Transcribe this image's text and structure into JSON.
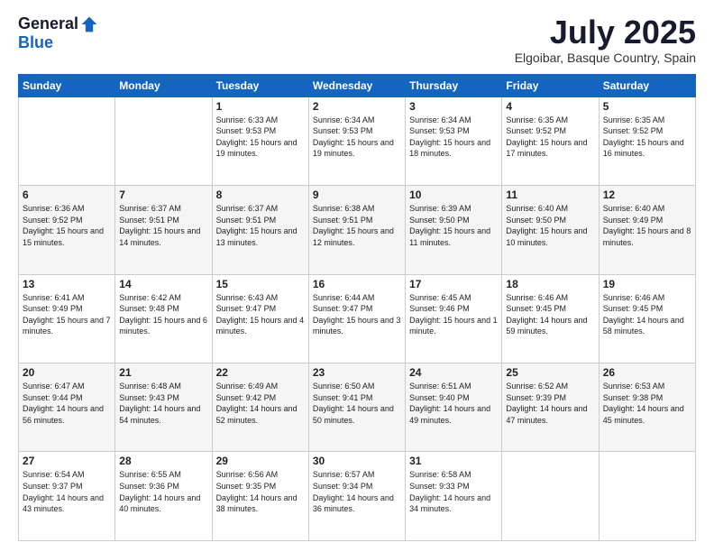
{
  "logo": {
    "general": "General",
    "blue": "Blue"
  },
  "title": "July 2025",
  "location": "Elgoibar, Basque Country, Spain",
  "days_of_week": [
    "Sunday",
    "Monday",
    "Tuesday",
    "Wednesday",
    "Thursday",
    "Friday",
    "Saturday"
  ],
  "weeks": [
    [
      {
        "day": null,
        "sunrise": null,
        "sunset": null,
        "daylight": null
      },
      {
        "day": null,
        "sunrise": null,
        "sunset": null,
        "daylight": null
      },
      {
        "day": "1",
        "sunrise": "Sunrise: 6:33 AM",
        "sunset": "Sunset: 9:53 PM",
        "daylight": "Daylight: 15 hours and 19 minutes."
      },
      {
        "day": "2",
        "sunrise": "Sunrise: 6:34 AM",
        "sunset": "Sunset: 9:53 PM",
        "daylight": "Daylight: 15 hours and 19 minutes."
      },
      {
        "day": "3",
        "sunrise": "Sunrise: 6:34 AM",
        "sunset": "Sunset: 9:53 PM",
        "daylight": "Daylight: 15 hours and 18 minutes."
      },
      {
        "day": "4",
        "sunrise": "Sunrise: 6:35 AM",
        "sunset": "Sunset: 9:52 PM",
        "daylight": "Daylight: 15 hours and 17 minutes."
      },
      {
        "day": "5",
        "sunrise": "Sunrise: 6:35 AM",
        "sunset": "Sunset: 9:52 PM",
        "daylight": "Daylight: 15 hours and 16 minutes."
      }
    ],
    [
      {
        "day": "6",
        "sunrise": "Sunrise: 6:36 AM",
        "sunset": "Sunset: 9:52 PM",
        "daylight": "Daylight: 15 hours and 15 minutes."
      },
      {
        "day": "7",
        "sunrise": "Sunrise: 6:37 AM",
        "sunset": "Sunset: 9:51 PM",
        "daylight": "Daylight: 15 hours and 14 minutes."
      },
      {
        "day": "8",
        "sunrise": "Sunrise: 6:37 AM",
        "sunset": "Sunset: 9:51 PM",
        "daylight": "Daylight: 15 hours and 13 minutes."
      },
      {
        "day": "9",
        "sunrise": "Sunrise: 6:38 AM",
        "sunset": "Sunset: 9:51 PM",
        "daylight": "Daylight: 15 hours and 12 minutes."
      },
      {
        "day": "10",
        "sunrise": "Sunrise: 6:39 AM",
        "sunset": "Sunset: 9:50 PM",
        "daylight": "Daylight: 15 hours and 11 minutes."
      },
      {
        "day": "11",
        "sunrise": "Sunrise: 6:40 AM",
        "sunset": "Sunset: 9:50 PM",
        "daylight": "Daylight: 15 hours and 10 minutes."
      },
      {
        "day": "12",
        "sunrise": "Sunrise: 6:40 AM",
        "sunset": "Sunset: 9:49 PM",
        "daylight": "Daylight: 15 hours and 8 minutes."
      }
    ],
    [
      {
        "day": "13",
        "sunrise": "Sunrise: 6:41 AM",
        "sunset": "Sunset: 9:49 PM",
        "daylight": "Daylight: 15 hours and 7 minutes."
      },
      {
        "day": "14",
        "sunrise": "Sunrise: 6:42 AM",
        "sunset": "Sunset: 9:48 PM",
        "daylight": "Daylight: 15 hours and 6 minutes."
      },
      {
        "day": "15",
        "sunrise": "Sunrise: 6:43 AM",
        "sunset": "Sunset: 9:47 PM",
        "daylight": "Daylight: 15 hours and 4 minutes."
      },
      {
        "day": "16",
        "sunrise": "Sunrise: 6:44 AM",
        "sunset": "Sunset: 9:47 PM",
        "daylight": "Daylight: 15 hours and 3 minutes."
      },
      {
        "day": "17",
        "sunrise": "Sunrise: 6:45 AM",
        "sunset": "Sunset: 9:46 PM",
        "daylight": "Daylight: 15 hours and 1 minute."
      },
      {
        "day": "18",
        "sunrise": "Sunrise: 6:46 AM",
        "sunset": "Sunset: 9:45 PM",
        "daylight": "Daylight: 14 hours and 59 minutes."
      },
      {
        "day": "19",
        "sunrise": "Sunrise: 6:46 AM",
        "sunset": "Sunset: 9:45 PM",
        "daylight": "Daylight: 14 hours and 58 minutes."
      }
    ],
    [
      {
        "day": "20",
        "sunrise": "Sunrise: 6:47 AM",
        "sunset": "Sunset: 9:44 PM",
        "daylight": "Daylight: 14 hours and 56 minutes."
      },
      {
        "day": "21",
        "sunrise": "Sunrise: 6:48 AM",
        "sunset": "Sunset: 9:43 PM",
        "daylight": "Daylight: 14 hours and 54 minutes."
      },
      {
        "day": "22",
        "sunrise": "Sunrise: 6:49 AM",
        "sunset": "Sunset: 9:42 PM",
        "daylight": "Daylight: 14 hours and 52 minutes."
      },
      {
        "day": "23",
        "sunrise": "Sunrise: 6:50 AM",
        "sunset": "Sunset: 9:41 PM",
        "daylight": "Daylight: 14 hours and 50 minutes."
      },
      {
        "day": "24",
        "sunrise": "Sunrise: 6:51 AM",
        "sunset": "Sunset: 9:40 PM",
        "daylight": "Daylight: 14 hours and 49 minutes."
      },
      {
        "day": "25",
        "sunrise": "Sunrise: 6:52 AM",
        "sunset": "Sunset: 9:39 PM",
        "daylight": "Daylight: 14 hours and 47 minutes."
      },
      {
        "day": "26",
        "sunrise": "Sunrise: 6:53 AM",
        "sunset": "Sunset: 9:38 PM",
        "daylight": "Daylight: 14 hours and 45 minutes."
      }
    ],
    [
      {
        "day": "27",
        "sunrise": "Sunrise: 6:54 AM",
        "sunset": "Sunset: 9:37 PM",
        "daylight": "Daylight: 14 hours and 43 minutes."
      },
      {
        "day": "28",
        "sunrise": "Sunrise: 6:55 AM",
        "sunset": "Sunset: 9:36 PM",
        "daylight": "Daylight: 14 hours and 40 minutes."
      },
      {
        "day": "29",
        "sunrise": "Sunrise: 6:56 AM",
        "sunset": "Sunset: 9:35 PM",
        "daylight": "Daylight: 14 hours and 38 minutes."
      },
      {
        "day": "30",
        "sunrise": "Sunrise: 6:57 AM",
        "sunset": "Sunset: 9:34 PM",
        "daylight": "Daylight: 14 hours and 36 minutes."
      },
      {
        "day": "31",
        "sunrise": "Sunrise: 6:58 AM",
        "sunset": "Sunset: 9:33 PM",
        "daylight": "Daylight: 14 hours and 34 minutes."
      },
      {
        "day": null,
        "sunrise": null,
        "sunset": null,
        "daylight": null
      },
      {
        "day": null,
        "sunrise": null,
        "sunset": null,
        "daylight": null
      }
    ]
  ]
}
